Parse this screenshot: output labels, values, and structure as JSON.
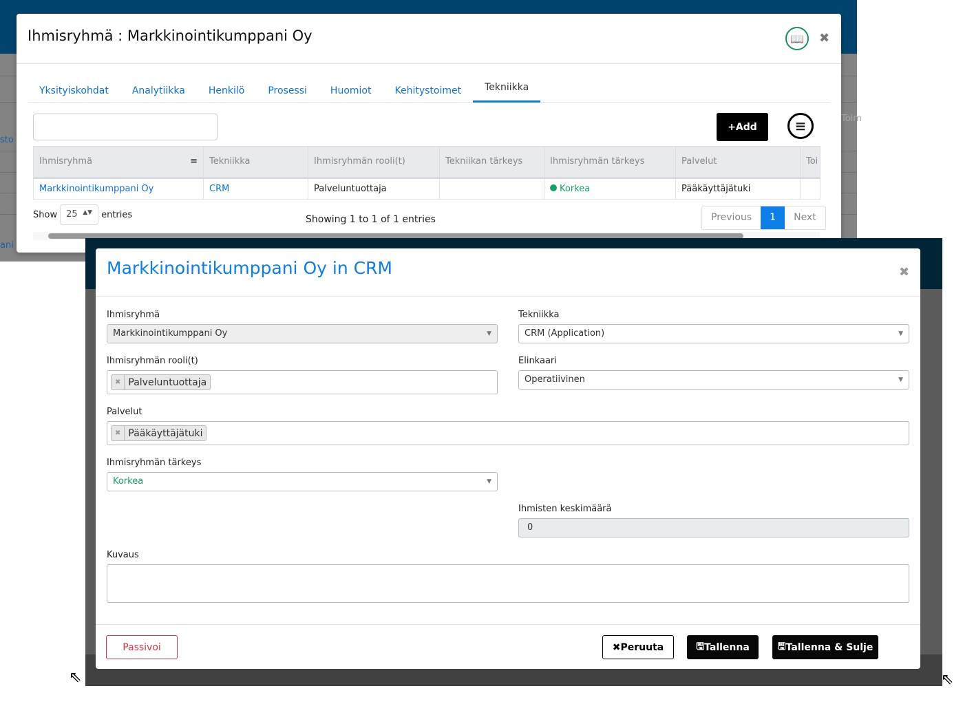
{
  "modal1": {
    "title": "Ihmisryhmä : Markkinointikumppani Oy",
    "tabs": [
      "Yksityiskohdat",
      "Analytiikka",
      "Henkilö",
      "Prosessi",
      "Huomiot",
      "Kehitystoimet",
      "Tekniikka"
    ],
    "active_tab": "Tekniikka",
    "add_label": "+Add",
    "search_value": "",
    "columns": [
      "Ihmisryhmä",
      "Tekniikka",
      "Ihmisryhmän rooli(t)",
      "Tekniikan tärkeys",
      "Ihmisryhmän tärkeys",
      "Palvelut",
      "Toi"
    ],
    "rows": [
      [
        "Markkinointikumppani Oy",
        "CRM",
        "Palveluntuottaja",
        "",
        "Korkea",
        "Pääkäyttäjätuki",
        ""
      ]
    ],
    "show_label": "Show",
    "page_size": "25",
    "entries_label": "entries",
    "info": "Showing 1 to 1 of 1 entries",
    "pager": {
      "prev": "Previous",
      "current": "1",
      "next": "Next"
    }
  },
  "background": {
    "texts": [
      "sto",
      "ani",
      "Toim"
    ]
  },
  "modal2": {
    "title": "Markkinointikumppani Oy in CRM",
    "fields": {
      "ihmisryhma": {
        "label": "Ihmisryhmä",
        "value": "Markkinointikumppani Oy"
      },
      "tekniikka": {
        "label": "Tekniikka",
        "value": "CRM (Application)"
      },
      "rooli": {
        "label": "Ihmisryhmän rooli(t)",
        "value": "Palveluntuottaja"
      },
      "elinkaari": {
        "label": "Elinkaari",
        "value": "Operatiivinen"
      },
      "palvelut": {
        "label": "Palvelut",
        "value": "Pääkäyttäjätuki"
      },
      "tarkeys": {
        "label": "Ihmisryhmän tärkeys",
        "value": "Korkea"
      },
      "keskimaara": {
        "label": "Ihmisten keskimäärä",
        "value": "0"
      },
      "kuvaus": {
        "label": "Kuvaus",
        "value": ""
      }
    },
    "buttons": {
      "passivoi": "Passivoi",
      "peruuta": "Peruuta",
      "tallenna": "Tallenna",
      "tallenna_sulje": "Tallenna & Sulje"
    }
  },
  "colors": {
    "accent": "#0d7fe8",
    "header": "#01446d",
    "success": "#12a36a",
    "danger": "#dc3545"
  }
}
